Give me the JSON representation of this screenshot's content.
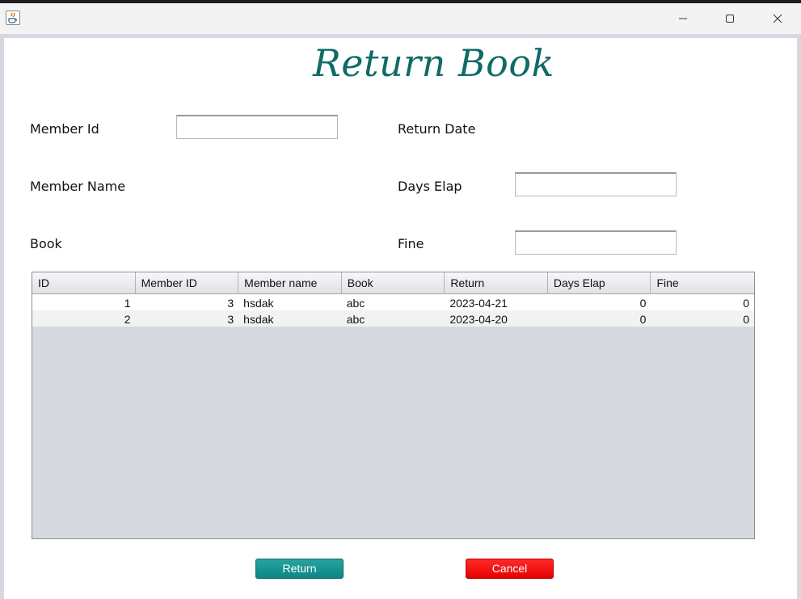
{
  "heading": "Return Book",
  "window_icon": "java-icon",
  "form": {
    "member_id_label": "Member Id",
    "member_id_value": "",
    "member_name_label": "Member Name",
    "book_label": "Book",
    "return_date_label": "Return Date",
    "days_elap_label": "Days Elap",
    "days_elap_value": "",
    "fine_label": "Fine",
    "fine_value": ""
  },
  "table": {
    "columns": [
      "ID",
      "Member ID",
      "Member name",
      "Book",
      "Return",
      "Days Elap",
      "Fine"
    ],
    "rows": [
      [
        "1",
        "3",
        "hsdak",
        "abc",
        "2023-04-21",
        "0",
        "0"
      ],
      [
        "2",
        "3",
        "hsdak",
        "abc",
        "2023-04-20",
        "0",
        "0"
      ]
    ]
  },
  "buttons": {
    "return_label": "Return",
    "cancel_label": "Cancel"
  },
  "colors": {
    "heading": "#0f6b66",
    "return_button": "#0d8684",
    "cancel_button": "#e40000"
  }
}
